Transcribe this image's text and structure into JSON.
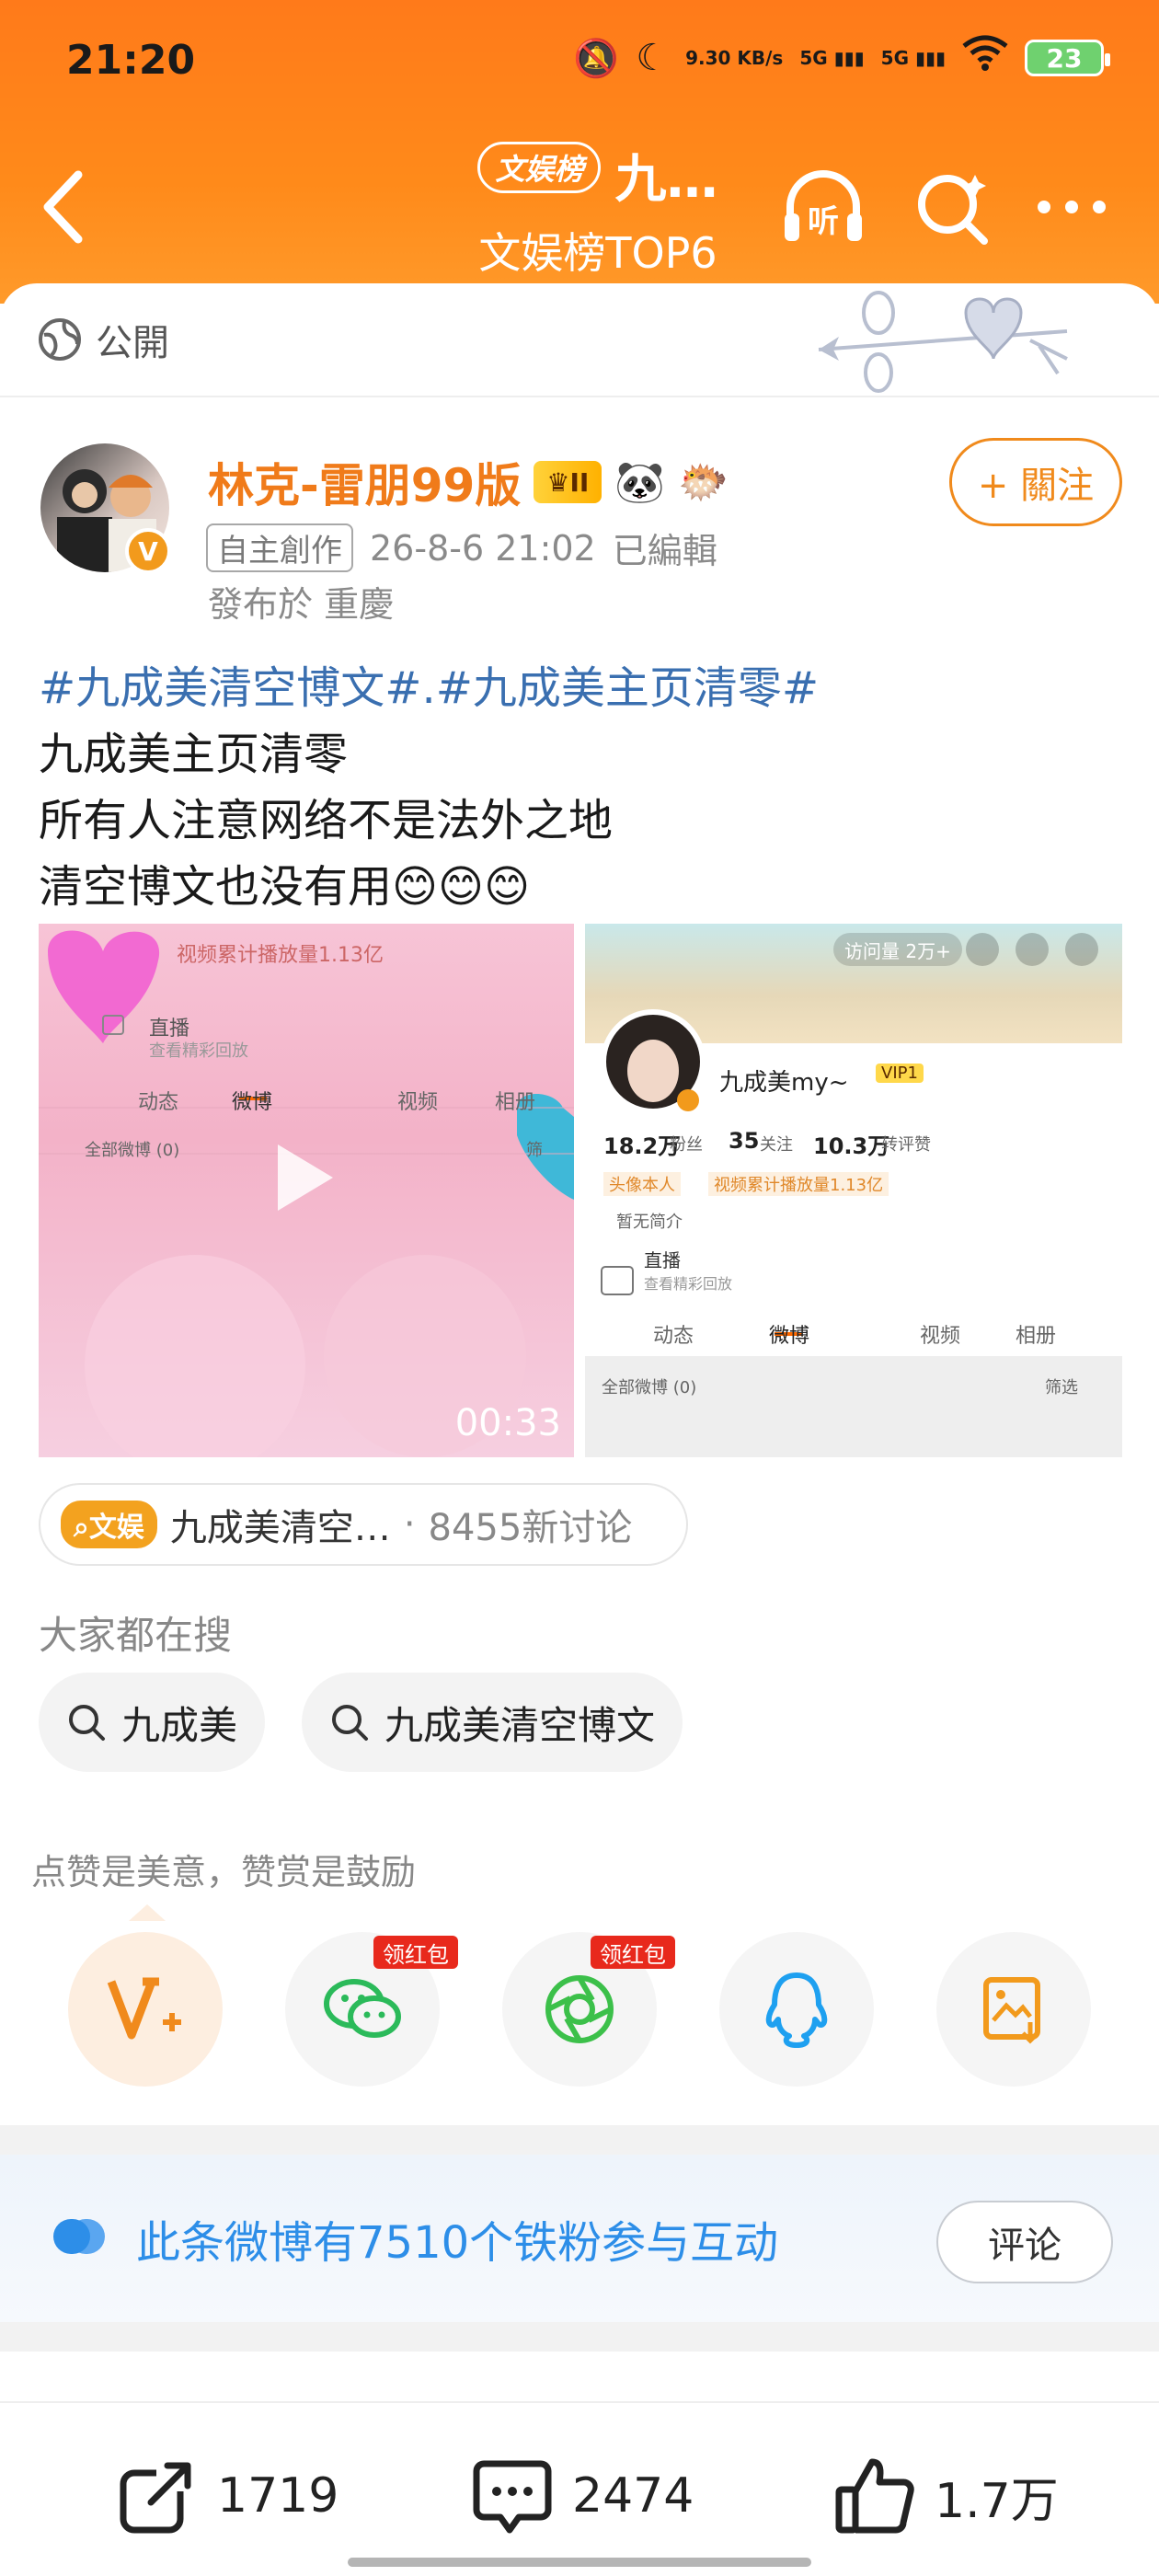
{
  "status_bar": {
    "time": "21:20",
    "net_speed": "9.30 KB/s",
    "signal1": "5G",
    "signal2": "5G",
    "battery": "23"
  },
  "header": {
    "badge": "文娱榜",
    "title": "九…",
    "subtitle": "文娱榜TOP6",
    "listen_label": "听"
  },
  "post": {
    "visibility": "公開",
    "author": "林克-雷朋99版",
    "level_badge": "II",
    "follow_label": "+ 關注",
    "source_tag": "自主創作",
    "datetime": "26-8-6 21:02",
    "edited": "已編輯",
    "location": "發布於 重慶",
    "hashtag_line": "#九成美清空博文#.#九成美主页清零#",
    "lines": [
      "九成美主页清零",
      "所有人注意网络不是法外之地",
      "清空博文也没有用😊😊😊"
    ],
    "video_duration": "00:33"
  },
  "left_image": {
    "stats": "视频累计播放量1.13亿",
    "live": "直播",
    "live_sub": "查看精彩回放",
    "tabs": [
      "动态",
      "微博",
      "视频",
      "相册"
    ],
    "all_weibo": "全部微博 (0)",
    "filter": "筛"
  },
  "right_image": {
    "visits": "访问量 2万+",
    "name": "九成美my~",
    "vip": "VIP1",
    "fans_num": "18.2万",
    "fans_label": "粉丝",
    "follow_num": "35",
    "follow_label": "关注",
    "likes_num": "10.3万",
    "likes_label": "转评赞",
    "tag1": "头像本人",
    "tag2": "视频累计播放量1.13亿",
    "intro": "暂无简介",
    "live": "直播",
    "live_sub": "查看精彩回放",
    "tabs": [
      "动态",
      "微博",
      "视频",
      "相册"
    ],
    "all_weibo": "全部微博 (0)",
    "filter": "筛选"
  },
  "topic": {
    "badge": "文娱",
    "name": "九成美清空…",
    "sep": "·",
    "count": "8455新讨论"
  },
  "search": {
    "label": "大家都在搜",
    "items": [
      "九成美",
      "九成美清空博文"
    ]
  },
  "reward": {
    "label": "点赞是美意，赞赏是鼓励",
    "red_tag": "领红包"
  },
  "fans_bar": {
    "text": "此条微博有7510个铁粉参与互动",
    "button": "评论"
  },
  "actions": {
    "repost": "1719",
    "comment": "2474",
    "like": "1.7万"
  },
  "colors": {
    "accent": "#f07b1a",
    "link": "#3a6fb0",
    "fans_blue": "#2d8ee8"
  }
}
